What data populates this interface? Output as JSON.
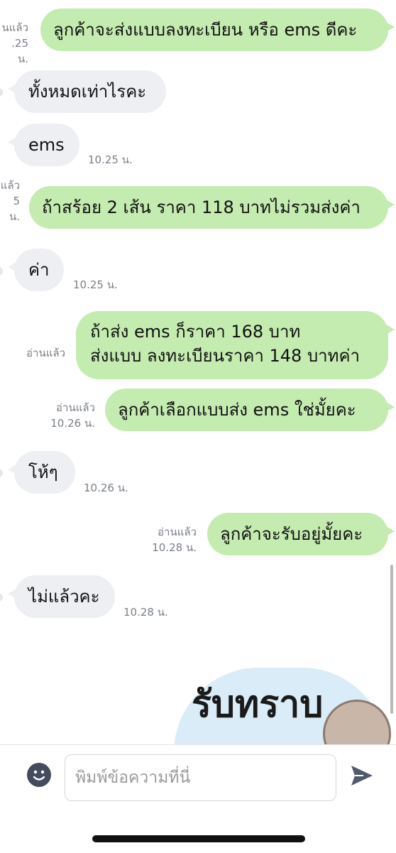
{
  "messages": [
    {
      "side": "me",
      "lines": [
        "ลูกค้าจะส่งแบบลงทะเบียน หรือ ems ดีคะ"
      ],
      "read": "นแล้ว",
      "time": ".25 น."
    },
    {
      "side": "them",
      "lines": [
        "ทั้งหมดเท่าไรคะ"
      ],
      "time": ""
    },
    {
      "side": "them",
      "lines": [
        "ems"
      ],
      "time": "10.25 น."
    },
    {
      "side": "me",
      "lines": [
        "ถ้าสร้อย 2 เส้น ราคา 118 บาทไม่รวมส่งค่า"
      ],
      "read": "แล้ว",
      "time": "5 น."
    },
    {
      "side": "them",
      "lines": [
        "ค่า"
      ],
      "time": "10.25 น."
    },
    {
      "side": "me",
      "lines": [
        "ถ้าส่ง ems ก็ราคา 168 บาท",
        "ส่งแบบ ลงทะเบียนราคา 148 บาทค่า"
      ],
      "read": "อ่านแล้ว",
      "time": ""
    },
    {
      "side": "me",
      "lines": [
        "ลูกค้าเลือกแบบส่ง ems ใช่มั้ยคะ"
      ],
      "read": "อ่านแล้ว",
      "time": "10.26 น."
    },
    {
      "side": "them",
      "lines": [
        "โห้ๆ"
      ],
      "time": "10.26 น."
    },
    {
      "side": "me",
      "lines": [
        "ลูกค้าจะรับอยู่มั้ยคะ"
      ],
      "read": "อ่านแล้ว",
      "time": "10.28 น."
    },
    {
      "side": "them",
      "lines": [
        "ไม่แล้วคะ"
      ],
      "time": "10.28 น."
    }
  ],
  "sticker": {
    "text": "รับทราบ"
  },
  "input": {
    "placeholder": "พิมพ์ข้อความที่นี่"
  },
  "icons": {
    "emoji": "emoji-icon",
    "send": "send-icon"
  },
  "colors": {
    "my_bubble": "#c4ebb0",
    "their_bubble": "#eeeff2",
    "meta_text": "#7a7f86"
  }
}
